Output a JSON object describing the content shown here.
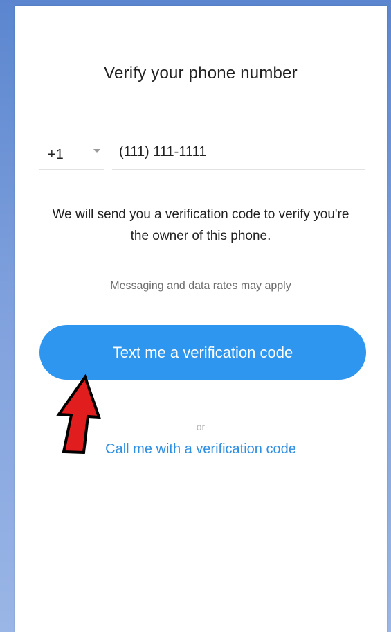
{
  "title": "Verify your phone number",
  "country": {
    "code": "+1",
    "icon": "chevron-down-icon"
  },
  "phone": {
    "value": "(111) 111-1111"
  },
  "description": {
    "line1": "We will send you a verification code to verify you're",
    "line2": "the owner of this phone."
  },
  "rates_notice": "Messaging and data rates may apply",
  "primary_button": {
    "label": "Text me a verification code",
    "color": "#2e96ef"
  },
  "separator": "or",
  "secondary_link": {
    "label": "Call me with a verification code",
    "color": "#2f8fe2"
  },
  "annotation": {
    "icon": "red-arrow-icon",
    "color": "#e11d1d"
  }
}
